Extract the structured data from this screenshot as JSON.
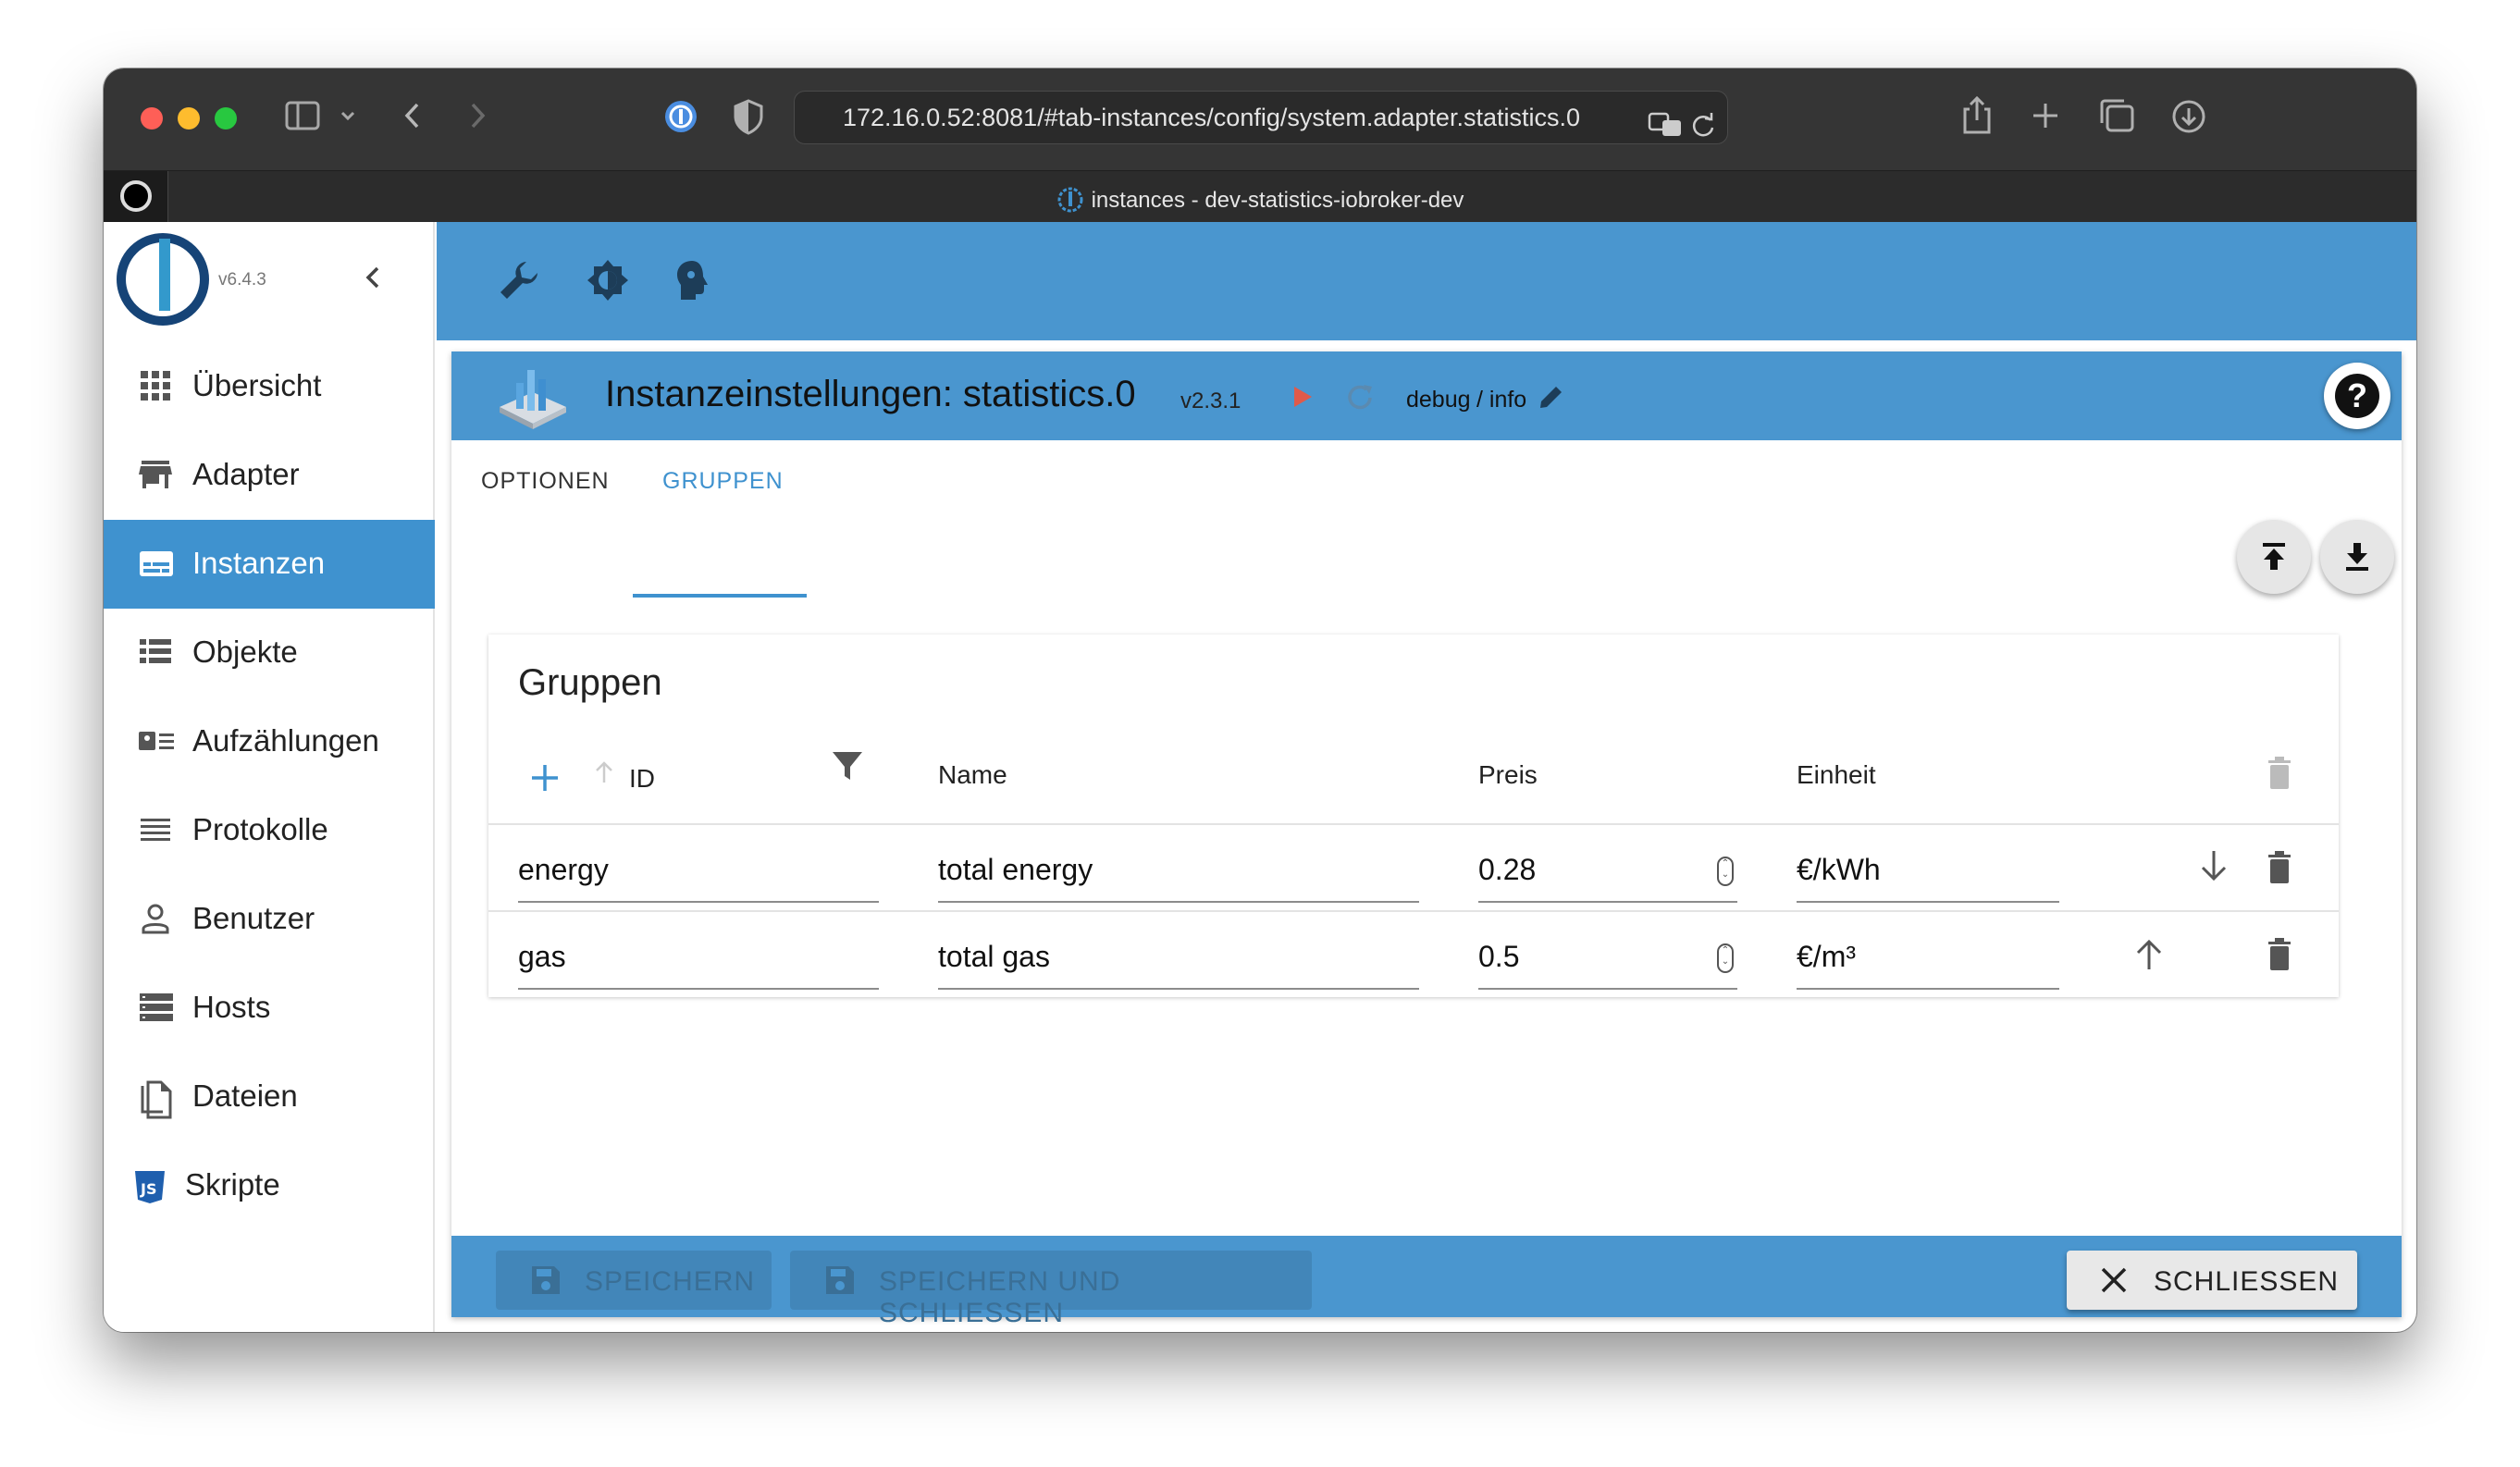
{
  "browser": {
    "url": "172.16.0.52:8081/#tab-instances/config/system.adapter.statistics.0",
    "tab_title": "instances - dev-statistics-iobroker-dev"
  },
  "sidebar": {
    "version": "v6.4.3",
    "items": [
      {
        "label": "Übersicht",
        "icon": "grid-icon"
      },
      {
        "label": "Adapter",
        "icon": "store-icon"
      },
      {
        "label": "Instanzen",
        "icon": "instances-icon"
      },
      {
        "label": "Objekte",
        "icon": "list-icon"
      },
      {
        "label": "Aufzählungen",
        "icon": "enum-icon"
      },
      {
        "label": "Protokolle",
        "icon": "log-icon"
      },
      {
        "label": "Benutzer",
        "icon": "user-icon"
      },
      {
        "label": "Hosts",
        "icon": "hosts-icon"
      },
      {
        "label": "Dateien",
        "icon": "files-icon"
      },
      {
        "label": "Skripte",
        "icon": "js-icon"
      }
    ]
  },
  "panel": {
    "title": "Instanzeinstellungen: statistics.0",
    "version": "v2.3.1",
    "log_level": "debug",
    "log_level_sep": "/ info",
    "tabs": [
      "OPTIONEN",
      "GRUPPEN"
    ],
    "active_tab": "GRUPPEN"
  },
  "groups": {
    "title": "Gruppen",
    "columns": {
      "id": "ID",
      "name": "Name",
      "price": "Preis",
      "unit": "Einheit"
    },
    "rows": [
      {
        "id": "energy",
        "name": "total energy",
        "price": "0.28",
        "unit": "€/kWh"
      },
      {
        "id": "gas",
        "name": "total gas",
        "price": "0.5",
        "unit": "€/m³"
      }
    ]
  },
  "footer": {
    "save": "SPEICHERN",
    "save_close": "SPEICHERN UND SCHLIESSEN",
    "close": "SCHLIESSEN"
  },
  "colors": {
    "accent": "#4a96cf",
    "active_nav": "#3f92cf",
    "play": "#e05a4a"
  }
}
